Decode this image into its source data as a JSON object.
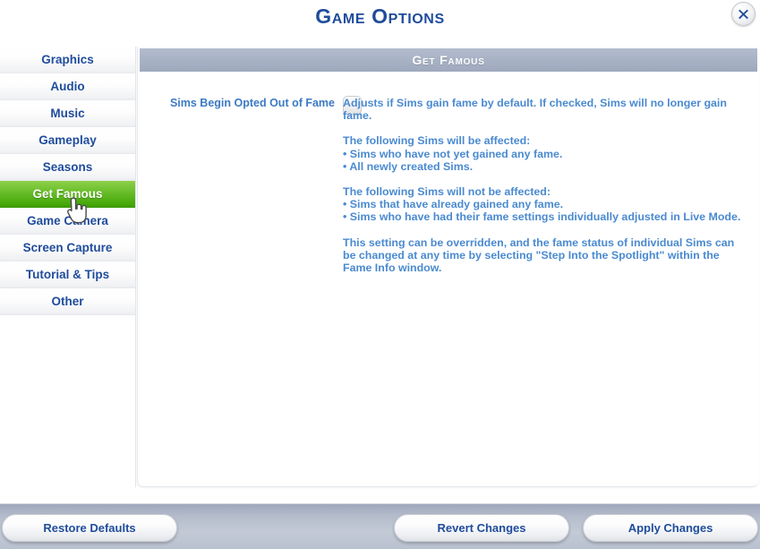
{
  "dialog": {
    "title": "Game Options",
    "close_icon": "close-x-icon"
  },
  "sidebar": {
    "items": [
      {
        "label": "Graphics",
        "selected": false
      },
      {
        "label": "Audio",
        "selected": false
      },
      {
        "label": "Music",
        "selected": false
      },
      {
        "label": "Gameplay",
        "selected": false
      },
      {
        "label": "Seasons",
        "selected": false
      },
      {
        "label": "Get Famous",
        "selected": true
      },
      {
        "label": "Game Camera",
        "selected": false
      },
      {
        "label": "Screen Capture",
        "selected": false
      },
      {
        "label": "Tutorial & Tips",
        "selected": false
      },
      {
        "label": "Other",
        "selected": false
      }
    ]
  },
  "panel": {
    "header": "Get Famous",
    "setting": {
      "label": "Sims Begin Opted Out of Fame",
      "checkbox_state": "unchecked",
      "description": {
        "intro": "Adjusts if Sims gain fame by default. If checked, Sims will no longer gain fame.",
        "affected_heading": "The following Sims will be affected:",
        "affected_items": [
          "• Sims who have not yet gained any fame.",
          "• All newly created Sims."
        ],
        "not_affected_heading": "The following Sims will not be affected:",
        "not_affected_items": [
          "• Sims that have already gained any fame.",
          "• Sims who have had their fame settings individually adjusted in Live Mode."
        ],
        "override_note": "This setting can be overridden, and the fame status of individual Sims can be changed at any time by selecting \"Step Into the Spotlight\" within the Fame Info window."
      }
    }
  },
  "footer": {
    "restore_label": "Restore Defaults",
    "revert_label": "Revert Changes",
    "apply_label": "Apply Changes"
  },
  "cursor": {
    "icon": "hand-pointer-cursor"
  },
  "colors": {
    "accent_blue": "#1f4c9c",
    "text_blue": "#4a8ad0",
    "selected_green": "#6dc02e",
    "header_gray": "#a8b2c5",
    "footer_gray": "#b5bdcc"
  }
}
